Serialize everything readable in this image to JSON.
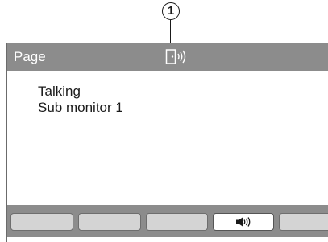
{
  "callout": {
    "number": "1"
  },
  "screen": {
    "title": "Page",
    "status_icon": "door-speaker-icon",
    "lines": [
      "Talking",
      "Sub monitor 1"
    ]
  },
  "softkeys": [
    {
      "label": "",
      "icon": "",
      "active": false
    },
    {
      "label": "",
      "icon": "",
      "active": false
    },
    {
      "label": "",
      "icon": "",
      "active": false
    },
    {
      "label": "",
      "icon": "speaker-icon",
      "active": true
    },
    {
      "label": "",
      "icon": "",
      "active": false
    }
  ],
  "colors": {
    "titlebar": "#8c8c8c",
    "softbar": "#8c8c8c",
    "softkey_inactive": "#d4d4d4",
    "softkey_active": "#ffffff"
  }
}
